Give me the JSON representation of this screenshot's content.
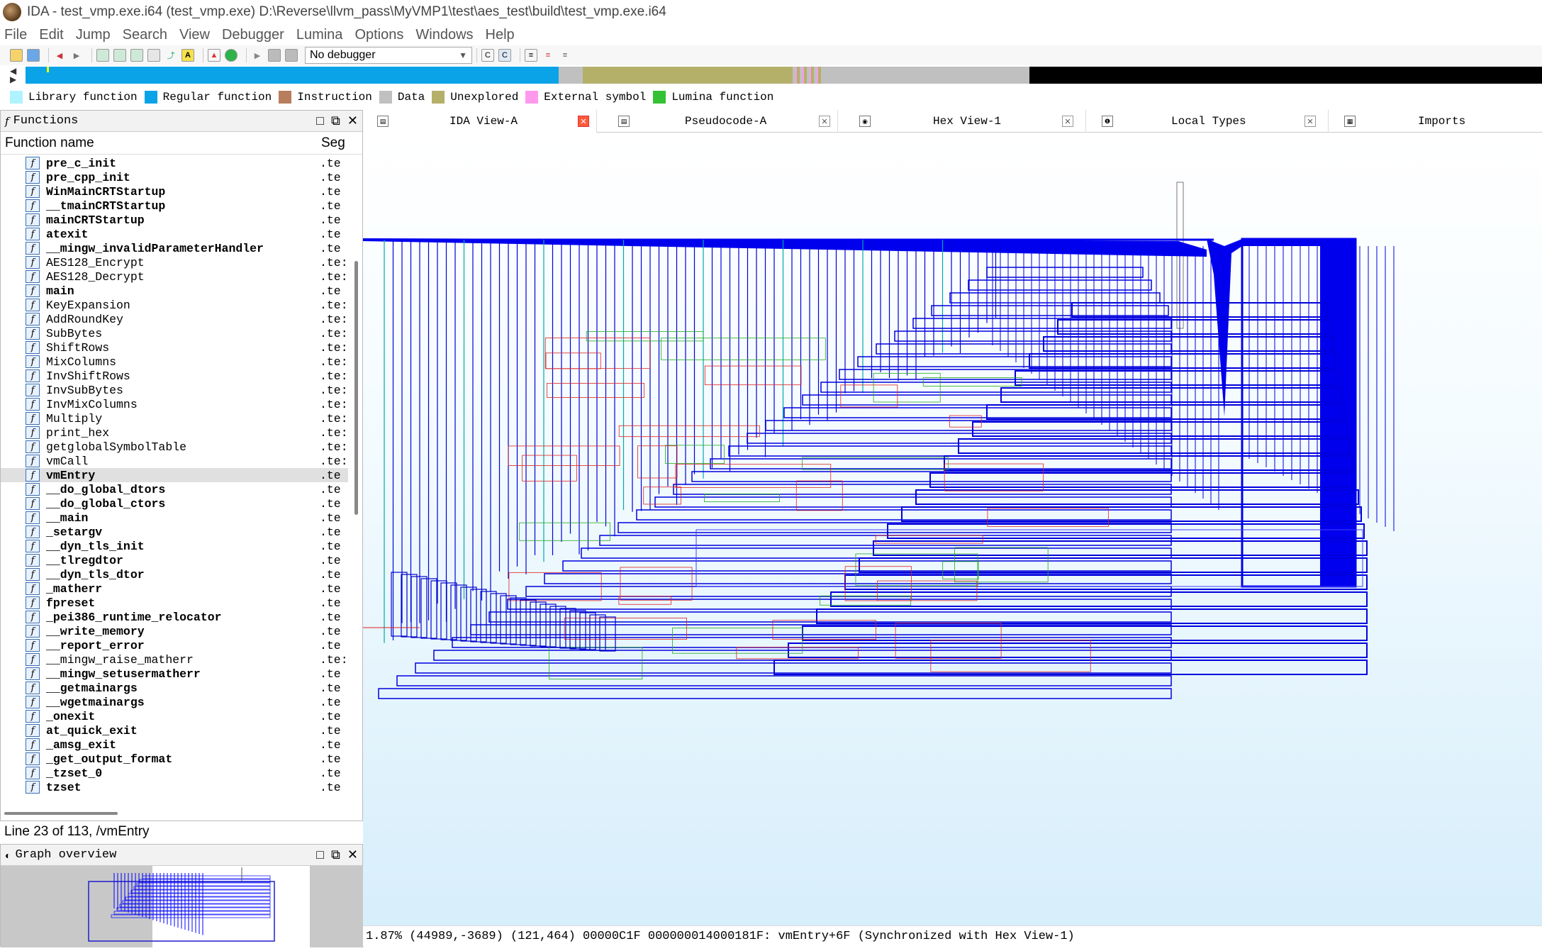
{
  "window": {
    "title": "IDA - test_vmp.exe.i64 (test_vmp.exe) D:\\Reverse\\llvm_pass\\MyVMP1\\test\\aes_test\\build\\test_vmp.exe.i64"
  },
  "menu": [
    "File",
    "Edit",
    "Jump",
    "Search",
    "View",
    "Debugger",
    "Lumina",
    "Options",
    "Windows",
    "Help"
  ],
  "toolbar": {
    "debugger_value": "No debugger"
  },
  "legend": [
    {
      "label": "Library function",
      "color": "#aef3ff"
    },
    {
      "label": "Regular function",
      "color": "#0ba3e8"
    },
    {
      "label": "Instruction",
      "color": "#b87d5c"
    },
    {
      "label": "Data",
      "color": "#c0c0c0"
    },
    {
      "label": "Unexplored",
      "color": "#b4b06a"
    },
    {
      "label": "External symbol",
      "color": "#ff99ee"
    },
    {
      "label": "Lumina function",
      "color": "#34c234"
    }
  ],
  "functions_panel": {
    "title": "Functions",
    "col_name": "Function name",
    "col_seg": "Seg",
    "items": [
      {
        "name": "pre_c_init",
        "seg": ".te"
      },
      {
        "name": "pre_cpp_init",
        "seg": ".te"
      },
      {
        "name": "WinMainCRTStartup",
        "seg": ".te"
      },
      {
        "name": "__tmainCRTStartup",
        "seg": ".te"
      },
      {
        "name": "mainCRTStartup",
        "seg": ".te"
      },
      {
        "name": "atexit",
        "seg": ".te"
      },
      {
        "name": "__mingw_invalidParameterHandler",
        "seg": ".te"
      },
      {
        "name": "AES128_Encrypt",
        "seg": ".te:"
      },
      {
        "name": "AES128_Decrypt",
        "seg": ".te:"
      },
      {
        "name": "main",
        "seg": ".te"
      },
      {
        "name": "KeyExpansion",
        "seg": ".te:"
      },
      {
        "name": "AddRoundKey",
        "seg": ".te:"
      },
      {
        "name": "SubBytes",
        "seg": ".te:"
      },
      {
        "name": "ShiftRows",
        "seg": ".te:"
      },
      {
        "name": "MixColumns",
        "seg": ".te:"
      },
      {
        "name": "InvShiftRows",
        "seg": ".te:"
      },
      {
        "name": "InvSubBytes",
        "seg": ".te:"
      },
      {
        "name": "InvMixColumns",
        "seg": ".te:"
      },
      {
        "name": "Multiply",
        "seg": ".te:"
      },
      {
        "name": "print_hex",
        "seg": ".te:"
      },
      {
        "name": "getglobalSymbolTable",
        "seg": ".te:"
      },
      {
        "name": "vmCall",
        "seg": ".te:"
      },
      {
        "name": "vmEntry",
        "seg": ".te"
      },
      {
        "name": "__do_global_dtors",
        "seg": ".te"
      },
      {
        "name": "__do_global_ctors",
        "seg": ".te"
      },
      {
        "name": "__main",
        "seg": ".te"
      },
      {
        "name": "_setargv",
        "seg": ".te"
      },
      {
        "name": "__dyn_tls_init",
        "seg": ".te"
      },
      {
        "name": "__tlregdtor",
        "seg": ".te"
      },
      {
        "name": "__dyn_tls_dtor",
        "seg": ".te"
      },
      {
        "name": "_matherr",
        "seg": ".te"
      },
      {
        "name": "fpreset",
        "seg": ".te"
      },
      {
        "name": "_pei386_runtime_relocator",
        "seg": ".te"
      },
      {
        "name": "__write_memory",
        "seg": ".te"
      },
      {
        "name": "__report_error",
        "seg": ".te"
      },
      {
        "name": "__mingw_raise_matherr",
        "seg": ".te:"
      },
      {
        "name": "__mingw_setusermatherr",
        "seg": ".te"
      },
      {
        "name": "__getmainargs",
        "seg": ".te"
      },
      {
        "name": "__wgetmainargs",
        "seg": ".te"
      },
      {
        "name": "_onexit",
        "seg": ".te"
      },
      {
        "name": "at_quick_exit",
        "seg": ".te"
      },
      {
        "name": "_amsg_exit",
        "seg": ".te"
      },
      {
        "name": "_get_output_format",
        "seg": ".te"
      },
      {
        "name": "_tzset_0",
        "seg": ".te"
      },
      {
        "name": "tzset",
        "seg": ".te"
      }
    ],
    "selected_index": 22,
    "status": "Line 23 of 113, /vmEntry"
  },
  "overview_panel": {
    "title": "Graph overview"
  },
  "tabs": [
    {
      "label": "IDA View-A",
      "icon": "listing-icon",
      "active": true
    },
    {
      "label": "Pseudocode-A",
      "icon": "code-icon",
      "active": false
    },
    {
      "label": "Hex View-1",
      "icon": "hex-icon",
      "active": false
    },
    {
      "label": "Local Types",
      "icon": "types-icon",
      "active": false
    },
    {
      "label": "Imports",
      "icon": "imports-icon",
      "active": false
    }
  ],
  "graph_status": "1.87% (44989,-3689) (121,464) 00000C1F 000000014000181F: vmEntry+6F (Synchronized with Hex View-1)"
}
